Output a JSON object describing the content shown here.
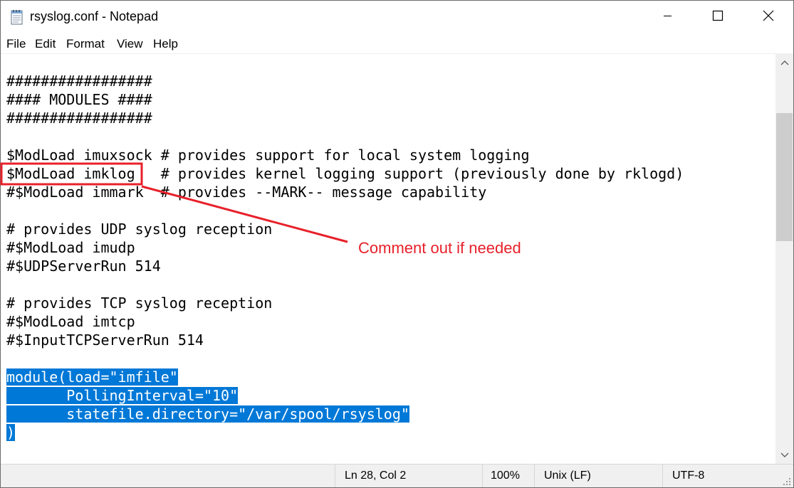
{
  "window": {
    "title": "rsyslog.conf - Notepad",
    "app_icon": "notepad-icon",
    "controls": [
      "minimize-icon",
      "maximize-icon",
      "close-icon"
    ]
  },
  "menu": {
    "file": "File",
    "edit": "Edit",
    "format": "Format",
    "view": "View",
    "help": "Help"
  },
  "editor": {
    "lines": [
      "#################",
      "#### MODULES ####",
      "#################",
      "",
      "$ModLoad imuxsock # provides support for local system logging",
      "$ModLoad imklog   # provides kernel logging support (previously done by rklogd)",
      "#$ModLoad immark  # provides --MARK-- message capability",
      "",
      "# provides UDP syslog reception",
      "#$ModLoad imudp",
      "#$UDPServerRun 514",
      "",
      "# provides TCP syslog reception",
      "#$ModLoad imtcp",
      "#$InputTCPServerRun 514",
      "",
      "module(load=\"imfile\"",
      "       PollingInterval=\"10\"",
      "       statefile.directory=\"/var/spool/rsyslog\"",
      ")"
    ],
    "selection_color": "#0078d7"
  },
  "statusbar": {
    "position": "Ln 28, Col 2",
    "zoom": "100%",
    "line_ending": "Unix (LF)",
    "encoding": "UTF-8"
  },
  "annotation": {
    "text": "Comment out if needed",
    "color": "#e8202a"
  }
}
